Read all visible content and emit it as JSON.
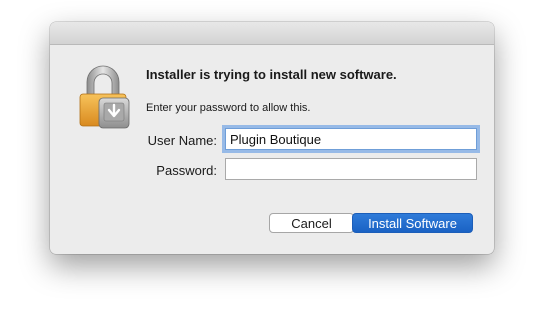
{
  "dialog": {
    "heading": "Installer is trying to install new software.",
    "subtext": "Enter your password to allow this.",
    "icon": "lock-icon",
    "fields": {
      "username_label": "User Name:",
      "username_value": "Plugin Boutique",
      "password_label": "Password:",
      "password_value": ""
    },
    "buttons": {
      "cancel_label": "Cancel",
      "install_label": "Install Software"
    },
    "colors": {
      "accent": "#1a62c4",
      "focus_ring": "#5292e3",
      "lock_body": "#f0a93a"
    }
  }
}
